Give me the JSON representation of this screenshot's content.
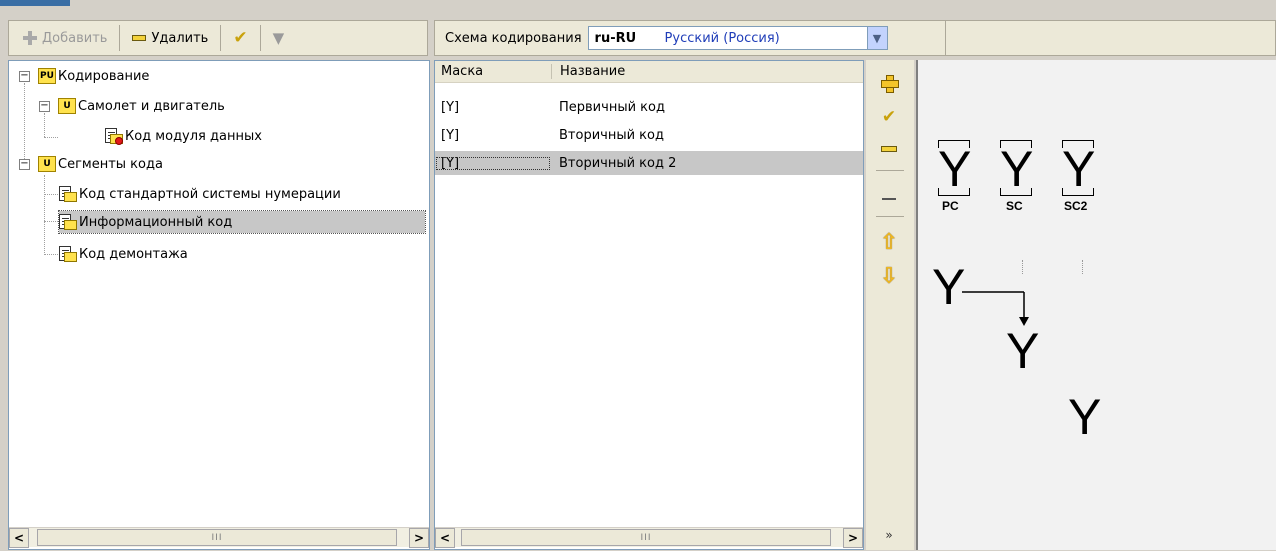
{
  "toolbar": {
    "add_label": "Добавить",
    "delete_label": "Удалить"
  },
  "scheme": {
    "label": "Схема кодирования",
    "code": "ru-RU",
    "language": "Русский (Россия)"
  },
  "tree": {
    "items": [
      {
        "label": "Кодирование"
      },
      {
        "label": "Самолет и двигатель"
      },
      {
        "label": "Код модуля данных"
      },
      {
        "label": "Сегменты кода"
      },
      {
        "label": "Код стандартной системы нумерации"
      },
      {
        "label": "Информационный код"
      },
      {
        "label": "Код демонтажа"
      }
    ],
    "selected_index": 5
  },
  "list": {
    "columns": [
      "Маска",
      "Название"
    ],
    "rows": [
      {
        "mask": "[Y]",
        "name": "Первичный код"
      },
      {
        "mask": "[Y]",
        "name": "Вторичный код"
      },
      {
        "mask": "[Y]",
        "name": "Вторичный код 2"
      }
    ],
    "selected_index": 2
  },
  "preview": {
    "glyph": "Y",
    "segments": [
      "PC",
      "SC",
      "SC2"
    ]
  },
  "scroll": {
    "thumb_grip": "III"
  },
  "colors": {
    "selection": "#c7c7c7",
    "panel_bg": "#ece9d8",
    "language_text": "#1f3db8"
  }
}
